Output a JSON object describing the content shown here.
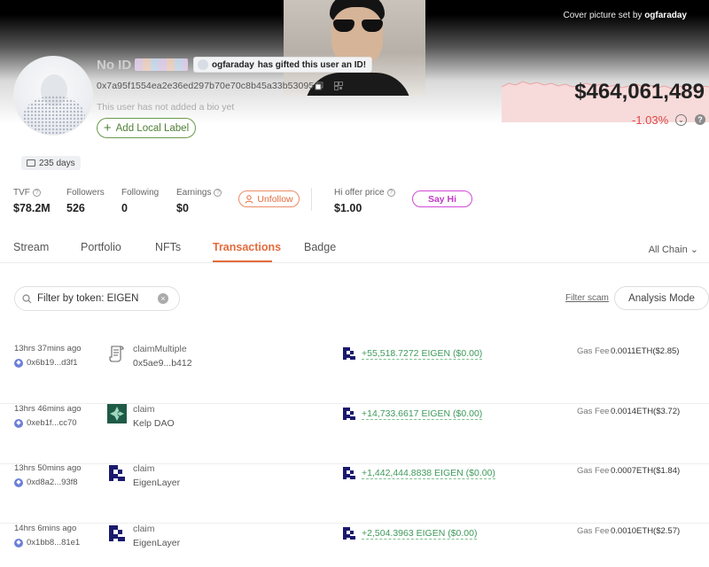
{
  "cover": {
    "credit_prefix": "Cover picture set by",
    "credit_user": "ogfaraday"
  },
  "profile": {
    "name": "No ID",
    "gift_user": "ogfaraday",
    "gift_text": "has gifted this user an ID!",
    "address": "0x7a95f1554ea2e36ed297b70e70c8b45a33b53095",
    "bio": "This user has not added a bio yet",
    "local_label_button": "Add Local Label",
    "days": "235 days"
  },
  "balance": {
    "value": "$464,061,489",
    "change": "-1.03%",
    "change_color": "#e04848"
  },
  "stats": {
    "tvf_label": "TVF",
    "tvf_value": "$78.2M",
    "followers_label": "Followers",
    "followers_value": "526",
    "following_label": "Following",
    "following_value": "0",
    "earnings_label": "Earnings",
    "earnings_value": "$0",
    "unfollow_button": "Unfollow",
    "hi_offer_label": "Hi offer price",
    "hi_offer_value": "$1.00",
    "say_hi_button": "Say Hi"
  },
  "tabs": {
    "stream": "Stream",
    "portfolio": "Portfolio",
    "nfts": "NFTs",
    "transactions": "Transactions",
    "badge": "Badge",
    "active": "Transactions",
    "chain_select": "All Chain"
  },
  "filters": {
    "search_value": "Filter by token: EIGEN",
    "filter_scam": "Filter scam",
    "analysis_mode": "Analysis Mode"
  },
  "transactions": [
    {
      "time": "13hrs 37mins ago",
      "hash": "0x6b19...d3f1",
      "method": "claimMultiple",
      "target": "0x5ae9...b412",
      "icon": "scroll-icon",
      "amount": "+55,518.7272 EIGEN ($0.00)",
      "gas_label": "Gas Fee",
      "gas_value": "0.0011ETH($2.85)"
    },
    {
      "time": "13hrs 46mins ago",
      "hash": "0xeb1f...cc70",
      "method": "claim",
      "target": "Kelp DAO",
      "icon": "kelp-dao-logo-icon",
      "amount": "+14,733.6617 EIGEN ($0.00)",
      "gas_label": "Gas Fee",
      "gas_value": "0.0014ETH($3.72)"
    },
    {
      "time": "13hrs 50mins ago",
      "hash": "0xd8a2...93f8",
      "method": "claim",
      "target": "EigenLayer",
      "icon": "eigenlayer-logo-icon",
      "amount": "+1,442,444.8838 EIGEN ($0.00)",
      "gas_label": "Gas Fee",
      "gas_value": "0.0007ETH($1.84)"
    },
    {
      "time": "14hrs 6mins ago",
      "hash": "0x1bb8...81e1",
      "method": "claim",
      "target": "EigenLayer",
      "icon": "eigenlayer-logo-icon",
      "amount": "+2,504.3963 EIGEN ($0.00)",
      "gas_label": "Gas Fee",
      "gas_value": "0.0010ETH($2.57)"
    }
  ],
  "colors": {
    "accent": "#e36b3c",
    "positive": "#3f9a5d",
    "negative": "#e04848",
    "say_hi": "#c13ac8",
    "local_label": "#4f7f35"
  }
}
